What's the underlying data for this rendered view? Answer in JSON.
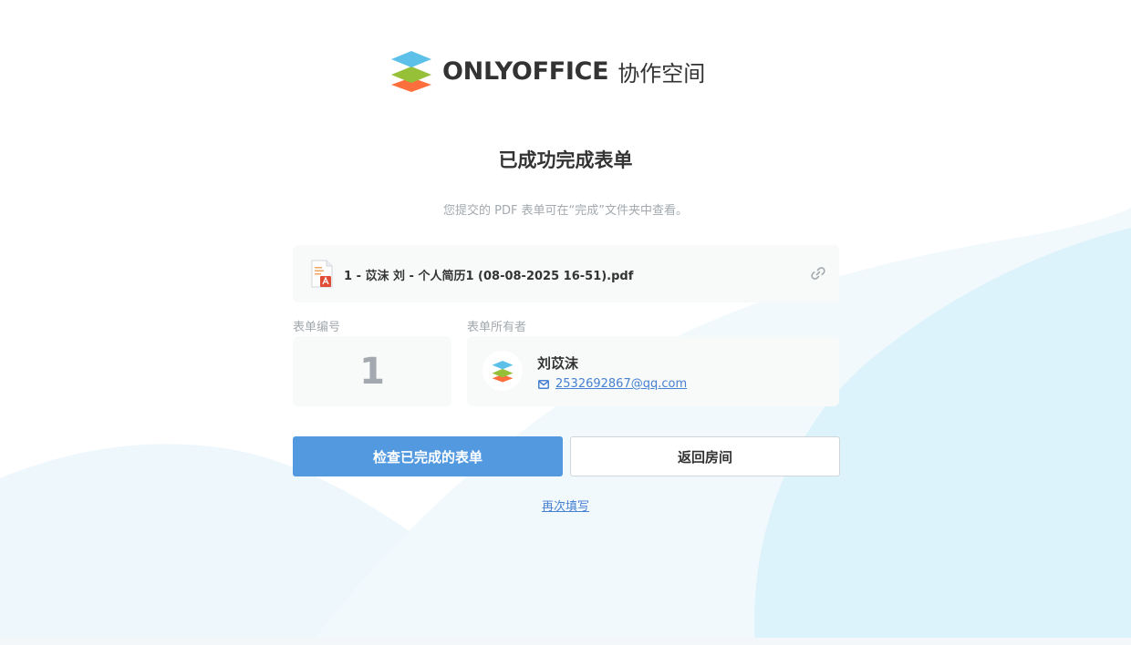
{
  "logo": {
    "brand": "ONLYOFFICE",
    "product": "协作空间"
  },
  "title": "已成功完成表单",
  "subtitle": "您提交的 PDF 表单可在“完成”文件夹中查看。",
  "file": {
    "name": "1 - 苡沫 刘 - 个人简历1 (08-08-2025 16-51).pdf",
    "icon": "pdf-file-icon"
  },
  "form_number": {
    "label": "表单编号",
    "value": "1"
  },
  "owner": {
    "label": "表单所有者",
    "name": "刘苡沫",
    "email": "2532692867@qq.com"
  },
  "buttons": {
    "check": "检查已完成的表单",
    "back": "返回房间"
  },
  "refill_link": "再次填写",
  "colors": {
    "primary": "#5299e0",
    "link": "#4781d1",
    "muted": "#a3a9ae",
    "card": "#f8f9f9"
  }
}
